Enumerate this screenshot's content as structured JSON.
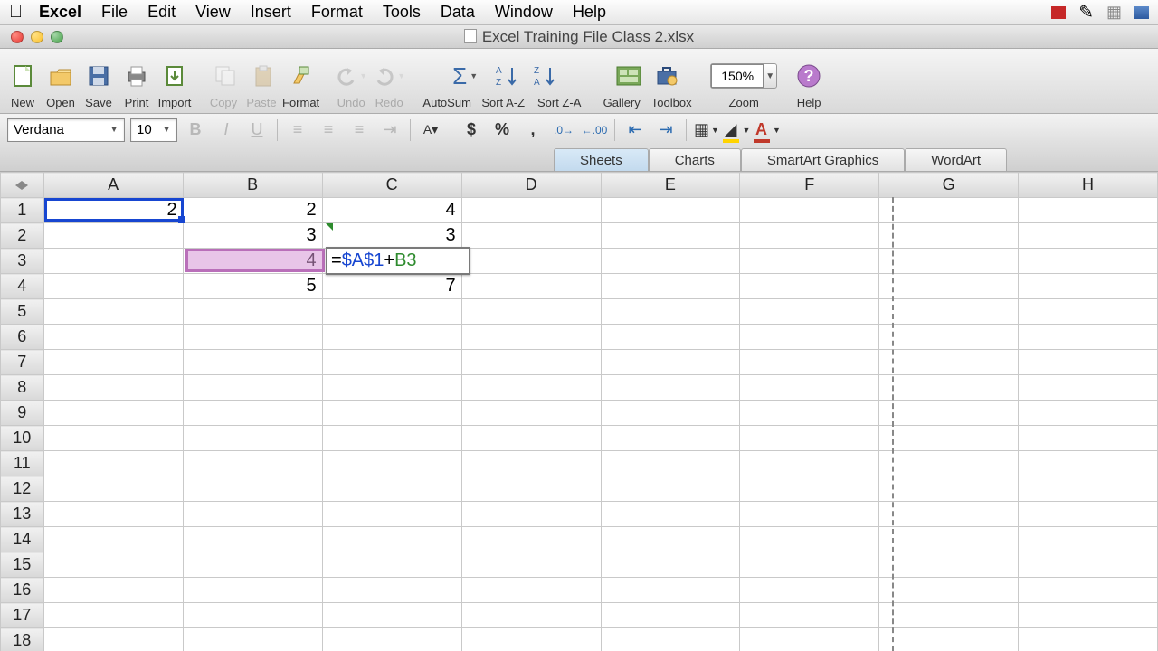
{
  "menubar": {
    "app": "Excel",
    "items": [
      "File",
      "Edit",
      "View",
      "Insert",
      "Format",
      "Tools",
      "Data",
      "Window",
      "Help"
    ]
  },
  "window": {
    "title": "Excel Training File Class 2.xlsx"
  },
  "toolbar": {
    "new": "New",
    "open": "Open",
    "save": "Save",
    "print": "Print",
    "import": "Import",
    "copy": "Copy",
    "paste": "Paste",
    "format": "Format",
    "undo": "Undo",
    "redo": "Redo",
    "autosum": "AutoSum",
    "sortaz": "Sort A-Z",
    "sortza": "Sort Z-A",
    "gallery": "Gallery",
    "toolbox": "Toolbox",
    "zoom": "Zoom",
    "zoom_value": "150%",
    "help": "Help"
  },
  "fmt": {
    "font": "Verdana",
    "size": "10"
  },
  "tabs": [
    "Sheets",
    "Charts",
    "SmartArt Graphics",
    "WordArt"
  ],
  "columns": [
    "A",
    "B",
    "C",
    "D",
    "E",
    "F",
    "G",
    "H"
  ],
  "rows": [
    "1",
    "2",
    "3",
    "4",
    "5",
    "6",
    "7",
    "8",
    "9",
    "10",
    "11",
    "12",
    "13",
    "14",
    "15",
    "16",
    "17",
    "18"
  ],
  "cells": {
    "A1": "2",
    "B1": "2",
    "C1": "4",
    "B2": "3",
    "C2": "3",
    "B3": "4",
    "B4": "5",
    "C4": "7"
  },
  "formula": {
    "prefix": "=",
    "ref1": "$A$1",
    "op": "+",
    "ref2": "B3"
  },
  "chart_data": {
    "type": "table",
    "columns": [
      "A",
      "B",
      "C"
    ],
    "rows": [
      {
        "A": 2,
        "B": 2,
        "C": 4
      },
      {
        "A": null,
        "B": 3,
        "C": 3
      },
      {
        "A": null,
        "B": 4,
        "C": "=$A$1+B3"
      },
      {
        "A": null,
        "B": 5,
        "C": 7
      }
    ]
  }
}
